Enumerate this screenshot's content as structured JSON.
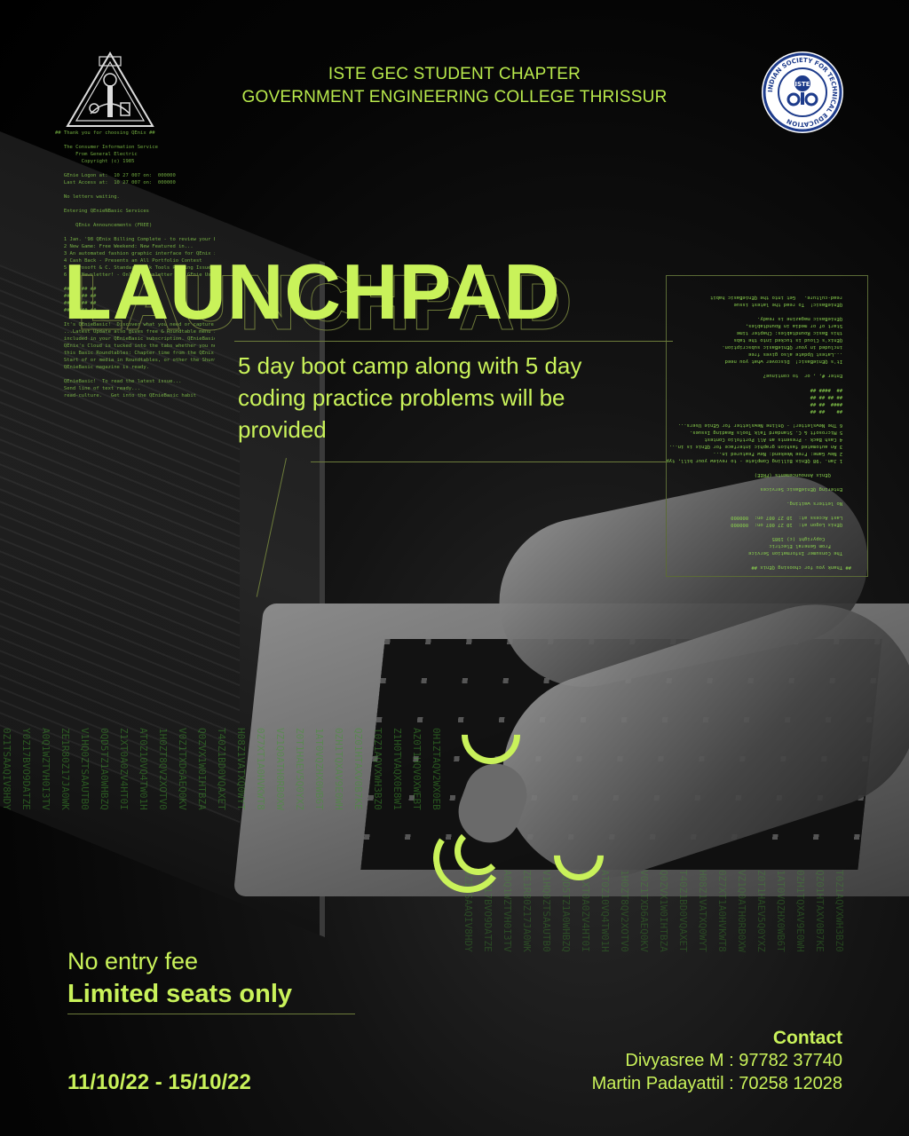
{
  "header": {
    "line1": "ISTE GEC STUDENT CHAPTER",
    "line2": "GOVERNMENT ENGINEERING COLLEGE THRISSUR"
  },
  "logos": {
    "left": "gec-thrissur-emblem",
    "right": "iste-logo",
    "right_ring_text": "INDIAN SOCIETY FOR TECHNICAL EDUCATION",
    "right_center_text": "ISTE"
  },
  "event": {
    "title": "LAUNCHPAD",
    "tagline_1": "5 day boot camp along with 5 day",
    "tagline_2": "coding practice problems will be",
    "tagline_3": "provided"
  },
  "info": {
    "fee": "No entry fee",
    "seats": "Limited seats only",
    "dates": "11/10/22  -  15/10/22"
  },
  "contact": {
    "heading": "Contact",
    "person1": "Divyasree M : 97782 37740",
    "person2": "Martin Padayattil : 70258 12028"
  },
  "colors": {
    "accent": "#c9f25a",
    "background": "#000000"
  }
}
